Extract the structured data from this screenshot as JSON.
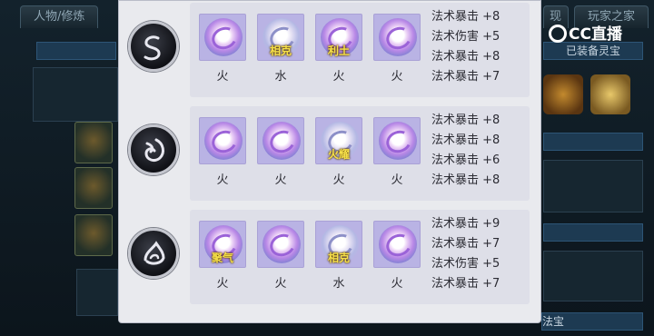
{
  "background": {
    "tabs": [
      {
        "label": "人物/修炼"
      },
      {
        "label": "现"
      },
      {
        "label": "玩家之家"
      }
    ],
    "bars": [
      {
        "label": "已装备灵宝"
      },
      {
        "label": "法宝"
      }
    ]
  },
  "watermark": {
    "text": "CC直播"
  },
  "groups": [
    {
      "badge_icon": "s-swirl-icon",
      "gems": [
        {
          "tag": "",
          "element": "火",
          "style": "purple"
        },
        {
          "tag": "相克",
          "element": "水",
          "style": "silver"
        },
        {
          "tag": "利土",
          "element": "火",
          "style": "purple"
        },
        {
          "tag": "",
          "element": "火",
          "style": "purple"
        }
      ],
      "stats": [
        "法术暴击 +8",
        "法术伤害 +5",
        "法术暴击 +8",
        "法术暴击 +7"
      ]
    },
    {
      "badge_icon": "flame-swirl-icon",
      "gems": [
        {
          "tag": "",
          "element": "火",
          "style": "purple"
        },
        {
          "tag": "",
          "element": "火",
          "style": "purple"
        },
        {
          "tag": "火耀",
          "element": "火",
          "style": "silver"
        },
        {
          "tag": "",
          "element": "火",
          "style": "purple"
        }
      ],
      "stats": [
        "法术暴击 +8",
        "法术暴击 +8",
        "法术暴击 +6",
        "法术暴击 +8"
      ]
    },
    {
      "badge_icon": "drop-swirl-icon",
      "gems": [
        {
          "tag": "聚气",
          "element": "火",
          "style": "purple"
        },
        {
          "tag": "",
          "element": "火",
          "style": "purple"
        },
        {
          "tag": "相克",
          "element": "水",
          "style": "silver"
        },
        {
          "tag": "",
          "element": "火",
          "style": "purple"
        }
      ],
      "stats": [
        "法术暴击 +9",
        "法术暴击 +7",
        "法术伤害 +5",
        "法术暴击 +7"
      ]
    }
  ]
}
